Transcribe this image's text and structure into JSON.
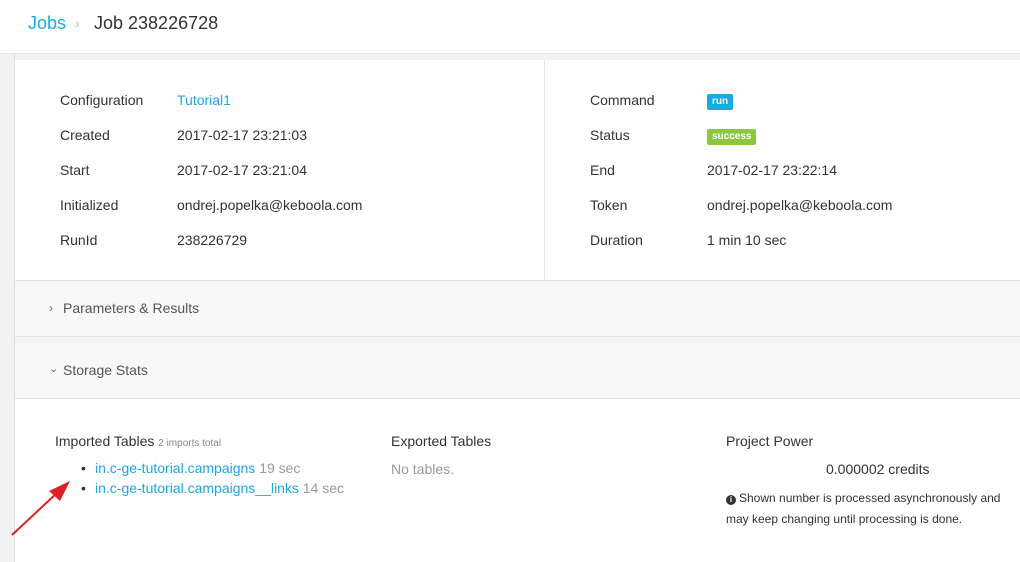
{
  "breadcrumb": {
    "root": "Jobs",
    "separator": "›",
    "current": "Job 238226728"
  },
  "details_left": [
    {
      "label": "Configuration",
      "value": "Tutorial1",
      "is_link": true
    },
    {
      "label": "Created",
      "value": "2017-02-17 23:21:03"
    },
    {
      "label": "Start",
      "value": "2017-02-17 23:21:04"
    },
    {
      "label": "Initialized",
      "value": "ondrej.popelka@keboola.com"
    },
    {
      "label": "RunId",
      "value": "238226729"
    }
  ],
  "details_right": {
    "command_label": "Command",
    "command_badge": "run",
    "status_label": "Status",
    "status_badge": "success",
    "end_label": "End",
    "end_value": "2017-02-17 23:22:14",
    "token_label": "Token",
    "token_value": "ondrej.popelka@keboola.com",
    "duration_label": "Duration",
    "duration_value": "1 min 10 sec"
  },
  "sections": {
    "params_title": "Parameters & Results",
    "storage_title": "Storage Stats"
  },
  "storage": {
    "imported_title": "Imported Tables",
    "imported_count": "2 imports total",
    "imported": [
      {
        "name": "in.c-ge-tutorial.campaigns",
        "time": "19 sec"
      },
      {
        "name": "in.c-ge-tutorial.campaigns__links",
        "time": "14 sec"
      }
    ],
    "exported_title": "Exported Tables",
    "exported_empty": "No tables.",
    "power_title": "Project Power",
    "power_value": "0.000002 credits",
    "power_note": "Shown number is processed asynchronously and may keep changing until processing is done."
  },
  "colors": {
    "link": "#1ba9e0",
    "success": "#8dc63f",
    "arrow": "#e02020"
  }
}
